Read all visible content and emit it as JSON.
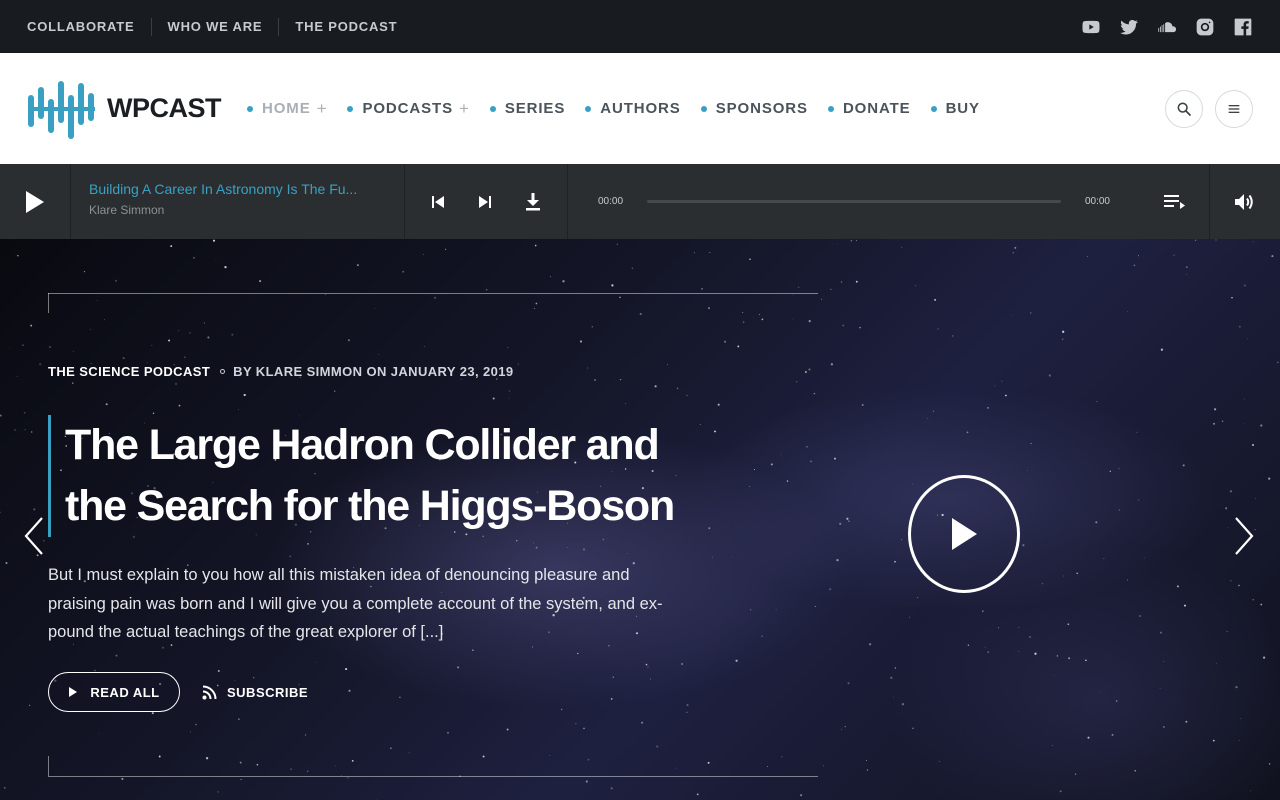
{
  "topbar": {
    "links": [
      "COLLABORATE",
      "WHO WE ARE",
      "THE PODCAST"
    ],
    "social_icons": [
      "youtube-icon",
      "twitter-icon",
      "soundcloud-icon",
      "instagram-icon",
      "facebook-icon"
    ]
  },
  "header": {
    "logo_text": "WPCAST",
    "nav": [
      {
        "label": "HOME",
        "has_submenu": true,
        "active": true
      },
      {
        "label": "PODCASTS",
        "has_submenu": true,
        "active": false
      },
      {
        "label": "SERIES",
        "has_submenu": false,
        "active": false
      },
      {
        "label": "AUTHORS",
        "has_submenu": false,
        "active": false
      },
      {
        "label": "SPONSORS",
        "has_submenu": false,
        "active": false
      },
      {
        "label": "DONATE",
        "has_submenu": false,
        "active": false
      },
      {
        "label": "BUY",
        "has_submenu": false,
        "active": false
      }
    ],
    "plus_glyph": "+"
  },
  "player": {
    "track_title": "Building A Career In Astronomy Is The Fu...",
    "track_author": "Klare Simmon",
    "time_current": "00:00",
    "time_total": "00:00",
    "progress": 0
  },
  "hero": {
    "category": "THE SCIENCE PODCAST",
    "byline": "BY KLARE SIMMON ON JANUARY 23, 2019",
    "title_line1": "The Large Hadron Collider and",
    "title_line2": "the Search for the Higgs-Boson",
    "excerpt_line1": "But I must explain to you how all this mistaken idea of denouncing pleasure and",
    "excerpt_line2": "praising pain was born and I will give you a complete account of the system, and ex-",
    "excerpt_line3": "pound the actual teachings of the great explorer of [...]",
    "read_all_label": "READ ALL",
    "subscribe_label": "SUBSCRIBE"
  },
  "colors": {
    "accent": "#3aa0c3",
    "topbar_bg": "#181c20",
    "player_bg": "#2b2e31",
    "nav_text": "#4b535b"
  }
}
